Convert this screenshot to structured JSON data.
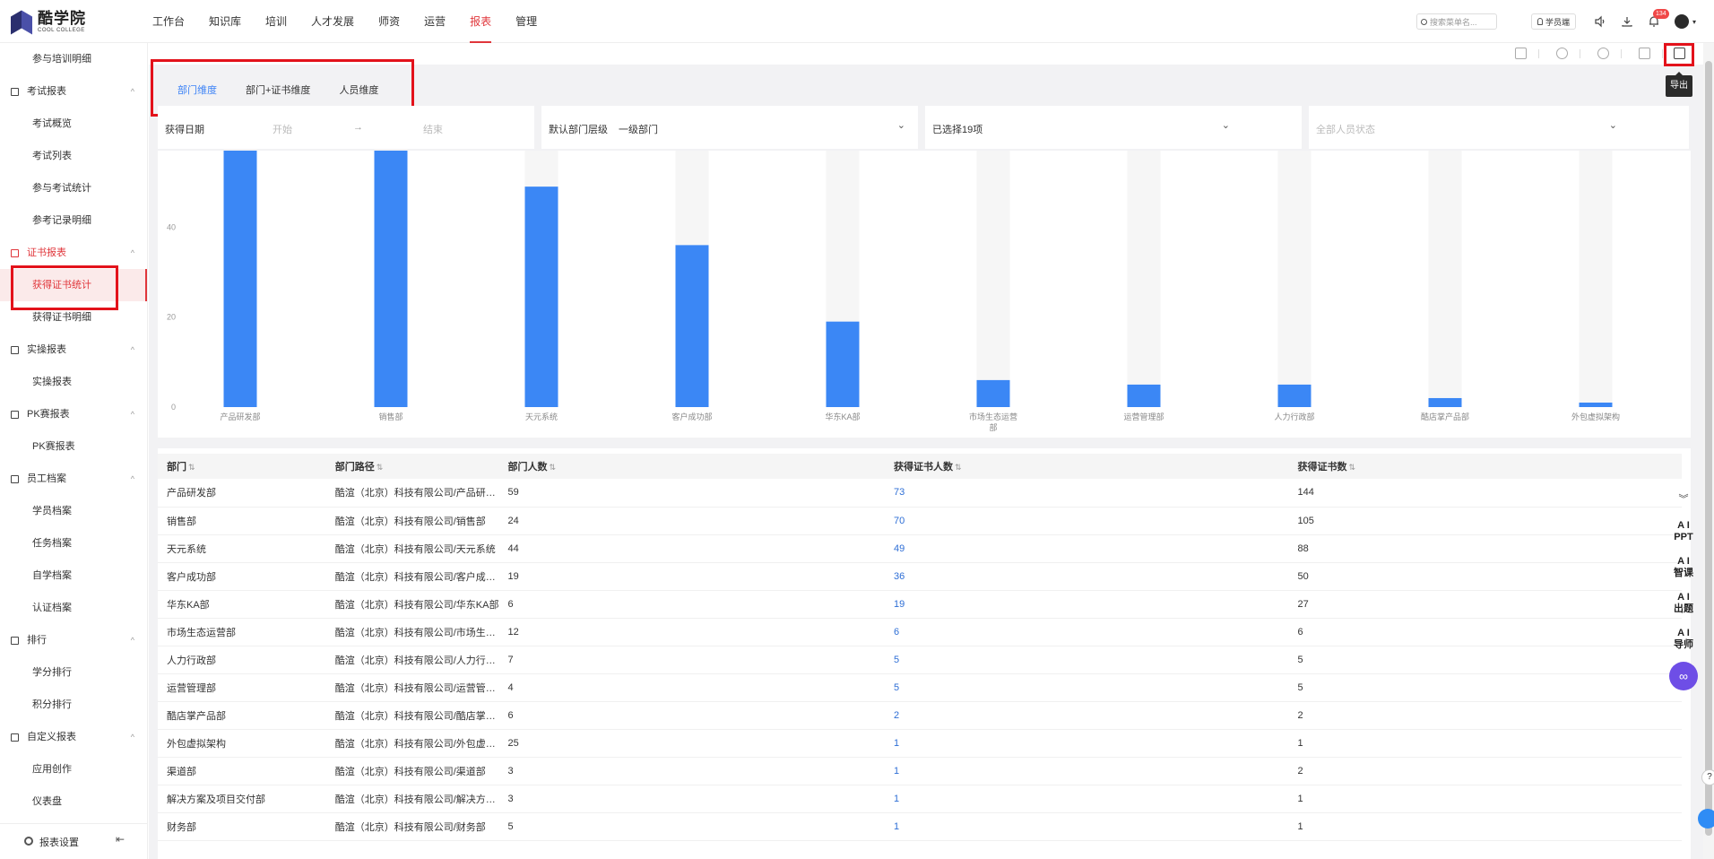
{
  "brand": {
    "name_cn": "酷学院",
    "name_en": "COOL COLLEGE"
  },
  "nav": [
    {
      "label": "工作台"
    },
    {
      "label": "知识库"
    },
    {
      "label": "培训"
    },
    {
      "label": "人才发展"
    },
    {
      "label": "师资"
    },
    {
      "label": "运营"
    },
    {
      "label": "报表",
      "active": true
    },
    {
      "label": "管理"
    }
  ],
  "top": {
    "search_placeholder": "搜索菜单名...",
    "student_label": "学员端",
    "badge_count": "134"
  },
  "sidebar": {
    "items": [
      {
        "type": "sub",
        "label": "参与培训明细"
      },
      {
        "type": "group",
        "label": "考试报表"
      },
      {
        "type": "sub",
        "label": "考试概览"
      },
      {
        "type": "sub",
        "label": "考试列表"
      },
      {
        "type": "sub",
        "label": "参与考试统计"
      },
      {
        "type": "sub",
        "label": "参考记录明细"
      },
      {
        "type": "group",
        "label": "证书报表",
        "active": true
      },
      {
        "type": "sub",
        "label": "获得证书统计",
        "active": true
      },
      {
        "type": "sub",
        "label": "获得证书明细"
      },
      {
        "type": "group",
        "label": "实操报表"
      },
      {
        "type": "sub",
        "label": "实操报表"
      },
      {
        "type": "group",
        "label": "PK赛报表"
      },
      {
        "type": "sub",
        "label": "PK赛报表"
      },
      {
        "type": "group",
        "label": "员工档案"
      },
      {
        "type": "sub",
        "label": "学员档案"
      },
      {
        "type": "sub",
        "label": "任务档案"
      },
      {
        "type": "sub",
        "label": "自学档案"
      },
      {
        "type": "sub",
        "label": "认证档案"
      },
      {
        "type": "group",
        "label": "排行"
      },
      {
        "type": "sub",
        "label": "学分排行"
      },
      {
        "type": "sub",
        "label": "积分排行"
      },
      {
        "type": "group",
        "label": "自定义报表"
      },
      {
        "type": "sub",
        "label": "应用创作"
      },
      {
        "type": "sub",
        "label": "仪表盘"
      }
    ],
    "footer_label": "报表设置"
  },
  "toolbar": {
    "export_tooltip": "导出"
  },
  "tabs": [
    {
      "label": "部门维度",
      "active": true
    },
    {
      "label": "部门+证书维度"
    },
    {
      "label": "人员维度"
    }
  ],
  "filters": {
    "date_label": "获得日期",
    "date_start": "开始",
    "date_arrow": "→",
    "date_end": "结束",
    "level_label": "默认部门层级",
    "level_value": "一级部门",
    "dept_value": "已选择19项",
    "status_placeholder": "全部人员状态"
  },
  "chart_data": {
    "type": "bar",
    "categories": [
      "产品研发部",
      "销售部",
      "天元系统",
      "客户成功部",
      "华东KA部",
      "市场生态运营部",
      "运营管理部",
      "人力行政部",
      "酷店掌产品部",
      "外包虚拟架构"
    ],
    "values": [
      73,
      70,
      49,
      36,
      19,
      6,
      5,
      5,
      2,
      1
    ],
    "ylim": [
      0,
      57
    ],
    "yticks": [
      0,
      20,
      40
    ],
    "bar_color": "#3b87f5",
    "track_color": "#f6f6f6"
  },
  "table": {
    "headers": [
      "部门",
      "部门路径",
      "部门人数",
      "获得证书人数",
      "获得证书数"
    ],
    "rows": [
      [
        "产品研发部",
        "酷渲（北京）科技有限公司/产品研…",
        "59",
        "73",
        "144"
      ],
      [
        "销售部",
        "酷渲（北京）科技有限公司/销售部",
        "24",
        "70",
        "105"
      ],
      [
        "天元系统",
        "酷渲（北京）科技有限公司/天元系统",
        "44",
        "49",
        "88"
      ],
      [
        "客户成功部",
        "酷渲（北京）科技有限公司/客户成…",
        "19",
        "36",
        "50"
      ],
      [
        "华东KA部",
        "酷渲（北京）科技有限公司/华东KA部",
        "6",
        "19",
        "27"
      ],
      [
        "市场生态运营部",
        "酷渲（北京）科技有限公司/市场生…",
        "12",
        "6",
        "6"
      ],
      [
        "人力行政部",
        "酷渲（北京）科技有限公司/人力行…",
        "7",
        "5",
        "5"
      ],
      [
        "运营管理部",
        "酷渲（北京）科技有限公司/运营管…",
        "4",
        "5",
        "5"
      ],
      [
        "酷店掌产品部",
        "酷渲（北京）科技有限公司/酷店掌…",
        "6",
        "2",
        "2"
      ],
      [
        "外包虚拟架构",
        "酷渲（北京）科技有限公司/外包虚…",
        "25",
        "1",
        "1"
      ],
      [
        "渠道部",
        "酷渲（北京）科技有限公司/渠道部",
        "3",
        "1",
        "2"
      ],
      [
        "解决方案及项目交付部",
        "酷渲（北京）科技有限公司/解决方…",
        "3",
        "1",
        "1"
      ],
      [
        "财务部",
        "酷渲（北京）科技有限公司/财务部",
        "5",
        "1",
        "1"
      ]
    ]
  },
  "ai_panel": [
    {
      "line1": "A I",
      "line2": "PPT"
    },
    {
      "line1": "A I",
      "line2": "智课"
    },
    {
      "line1": "A I",
      "line2": "出题"
    },
    {
      "line1": "A I",
      "line2": "导师"
    }
  ],
  "help_label": "?"
}
